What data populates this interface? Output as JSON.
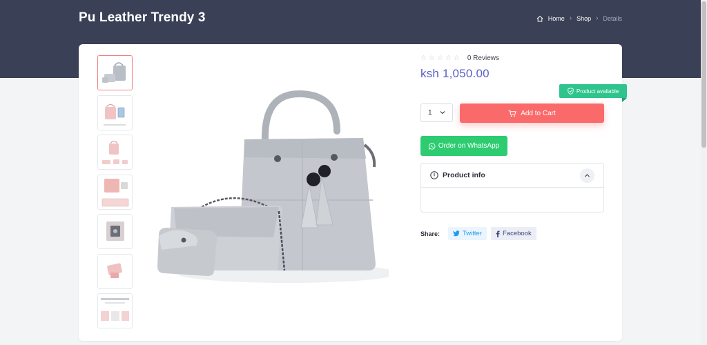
{
  "header": {
    "title": "Pu Leather Trendy 3",
    "breadcrumb": [
      "Home",
      "Shop",
      "Details"
    ]
  },
  "gallery": {
    "thumbnail_count": 7,
    "active_index": 0
  },
  "product": {
    "reviews_label": "0 Reviews",
    "rating_stars": 0,
    "price": "ksh 1,050.00",
    "availability": "Product available",
    "quantity": "1",
    "add_to_cart_label": "Add to Cart",
    "whatsapp_label": "Order on WhatsApp",
    "info_title": "Product info"
  },
  "share": {
    "label": "Share:",
    "twitter": "Twitter",
    "facebook": "Facebook"
  },
  "colors": {
    "hero": "#3a4156",
    "price": "#5b5fc7",
    "add_to_cart": "#fa6a6a",
    "whatsapp": "#2ecc71",
    "badge": "#2fc48e",
    "thumb_active_border": "#f08080"
  },
  "icons": {
    "breadcrumb_home": "home-icon",
    "cart": "cart-icon",
    "whatsapp": "whatsapp-icon",
    "info": "info-icon",
    "badge": "shield-check-icon",
    "twitter": "twitter-icon",
    "facebook": "facebook-icon"
  }
}
